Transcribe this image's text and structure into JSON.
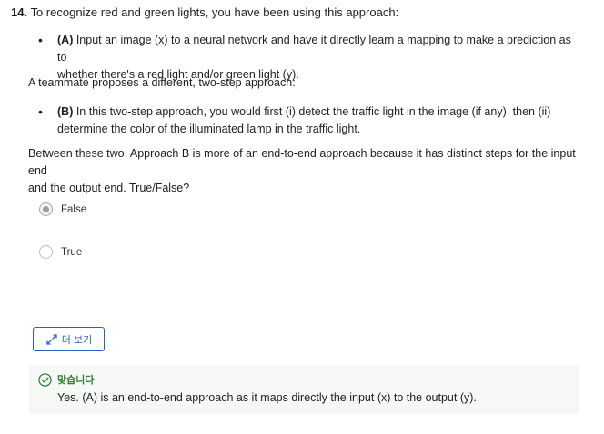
{
  "question": {
    "number": "14.",
    "text": " To recognize red and green lights, you have been using this approach:"
  },
  "approach_a": {
    "label": "(A)",
    "line1": " Input an image (x) to a neural network and have it directly learn a mapping to make a prediction as to",
    "line2": "whether there's a red light and/or green light (y)."
  },
  "teammate_text": "A teammate proposes a different, two-step approach:",
  "approach_b": {
    "label": "(B)",
    "line1": " In this two-step approach, you would first (i) detect the traffic light in the image (if any), then (ii)",
    "line2": "determine the color of the illuminated lamp in the traffic light."
  },
  "statement": {
    "line1": "Between these two, Approach B is more of an end-to-end approach because it has distinct steps for the input end",
    "line2": "and the output end. True/False?"
  },
  "options": [
    {
      "label": "False",
      "selected": true
    },
    {
      "label": "True",
      "selected": false
    }
  ],
  "more_button": {
    "label": "더 보기",
    "icon": "expand-icon"
  },
  "feedback": {
    "status": "맞습니다",
    "icon": "check-circle-icon",
    "status_color": "#2e7d32",
    "text": "Yes. (A) is an end-to-end approach as it maps directly the input (x) to the output (y)."
  },
  "colors": {
    "accent": "#2a5fc9",
    "success": "#2e7d32",
    "feedback_bg": "#f5f8f5"
  }
}
